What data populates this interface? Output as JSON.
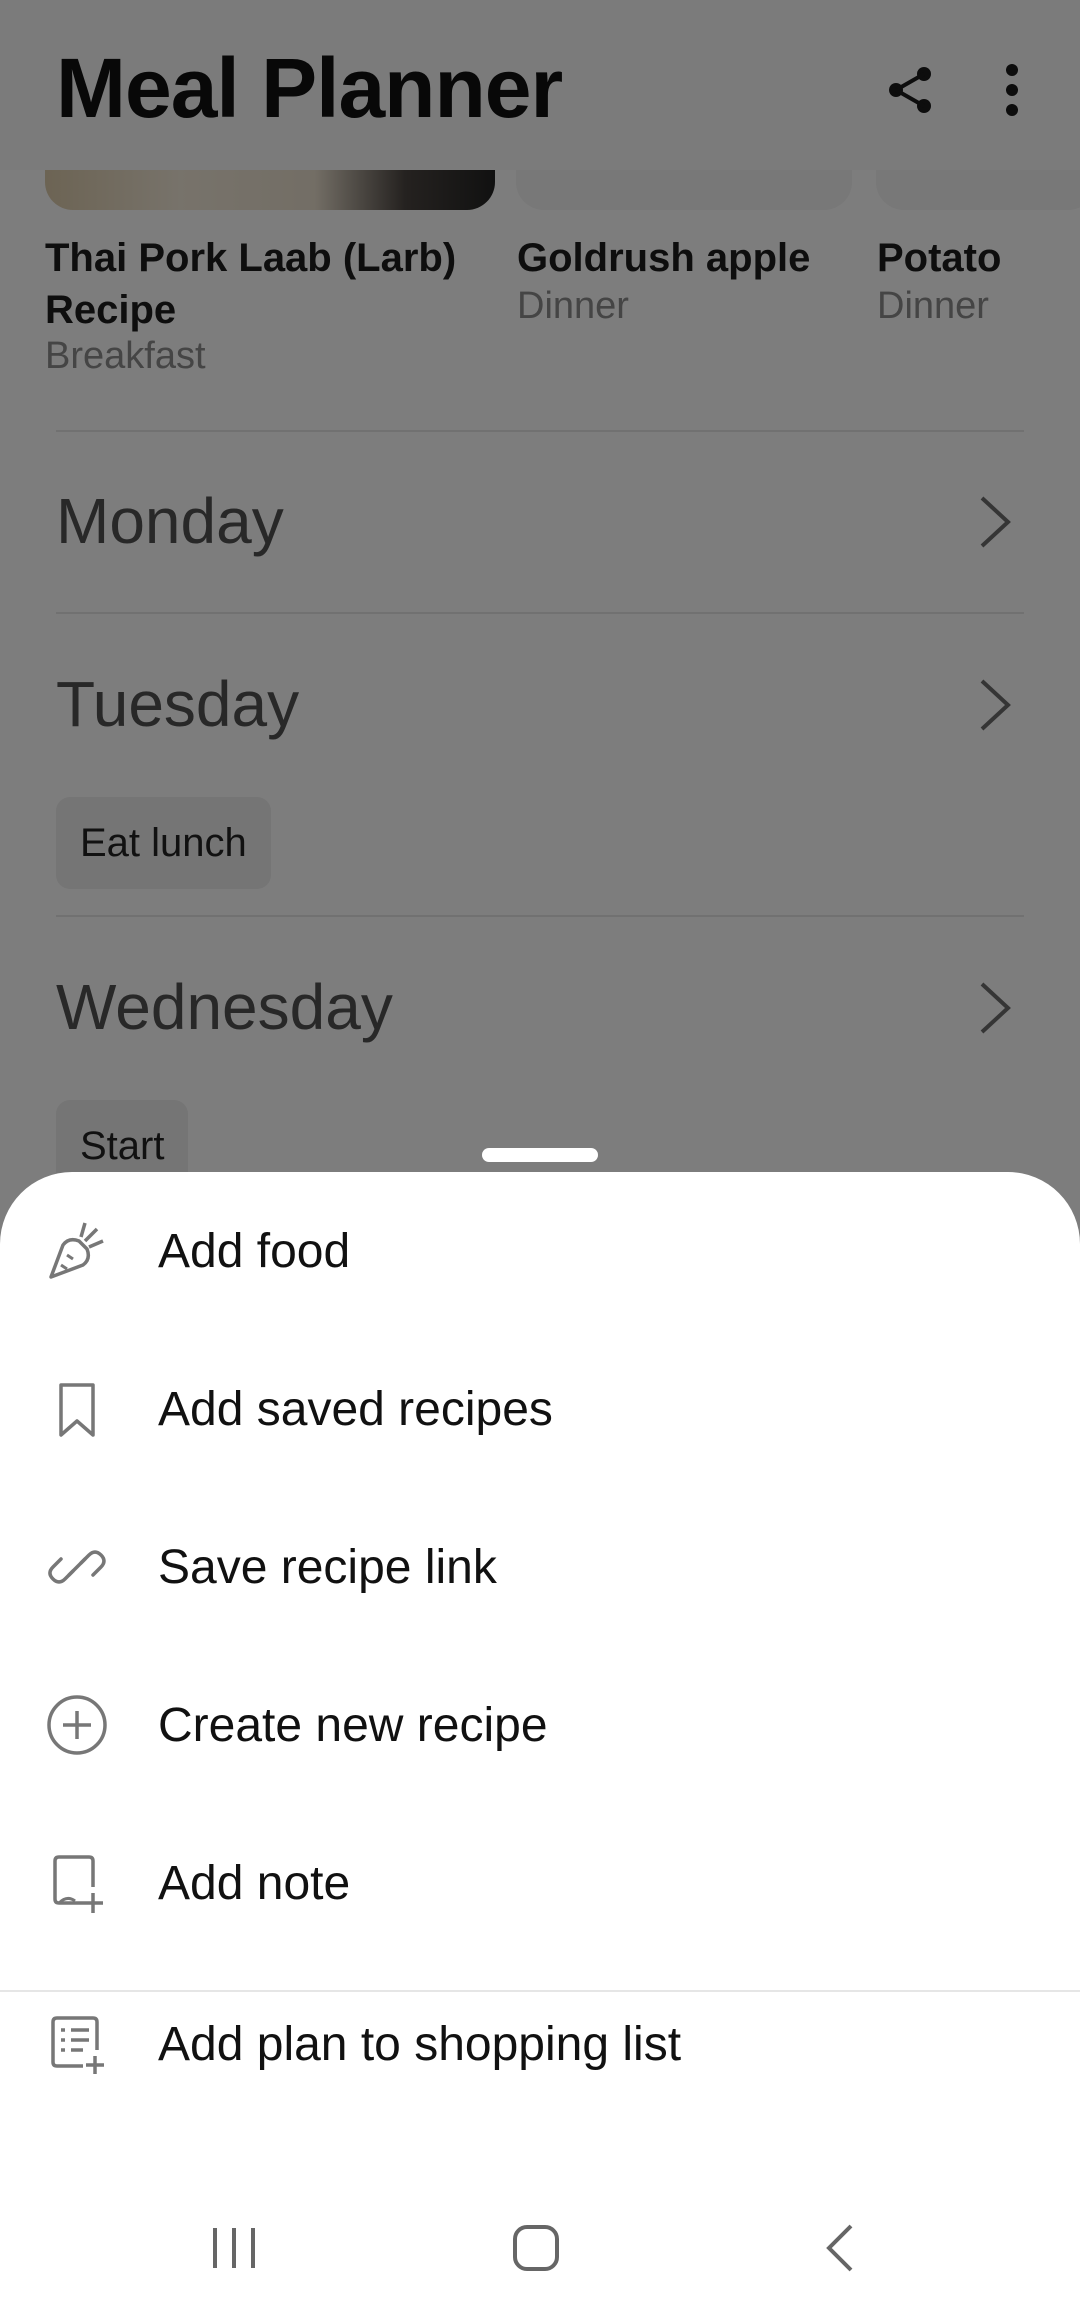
{
  "header": {
    "title": "Meal Planner",
    "share_icon": "share-icon",
    "more_icon": "more-vert-icon"
  },
  "recipes": [
    {
      "name": "Thai Pork Laab (Larb) Recipe",
      "meal": "Breakfast"
    },
    {
      "name": "Goldrush apple",
      "meal": "Dinner"
    },
    {
      "name": "Potato",
      "meal": "Dinner"
    }
  ],
  "days": [
    {
      "label": "Monday",
      "chip": ""
    },
    {
      "label": "Tuesday",
      "chip": "Eat lunch"
    },
    {
      "label": "Wednesday",
      "chip": "Start"
    }
  ],
  "sheet": {
    "items": [
      {
        "label": "Add food",
        "icon": "carrot-icon"
      },
      {
        "label": "Add saved recipes",
        "icon": "bookmark-icon"
      },
      {
        "label": "Save recipe link",
        "icon": "link-icon"
      },
      {
        "label": "Create new recipe",
        "icon": "add-circle-icon"
      },
      {
        "label": "Add note",
        "icon": "note-add-icon"
      },
      {
        "label": "Add plan to shopping list",
        "icon": "list-add-icon"
      }
    ]
  },
  "navbar": {
    "recents_icon": "recents-icon",
    "home_icon": "home-icon",
    "back_icon": "back-icon"
  },
  "colors": {
    "scrim": "#000000",
    "sheet_bg": "#ffffff",
    "text_primary": "#111111",
    "text_secondary": "#8a8a8a"
  }
}
